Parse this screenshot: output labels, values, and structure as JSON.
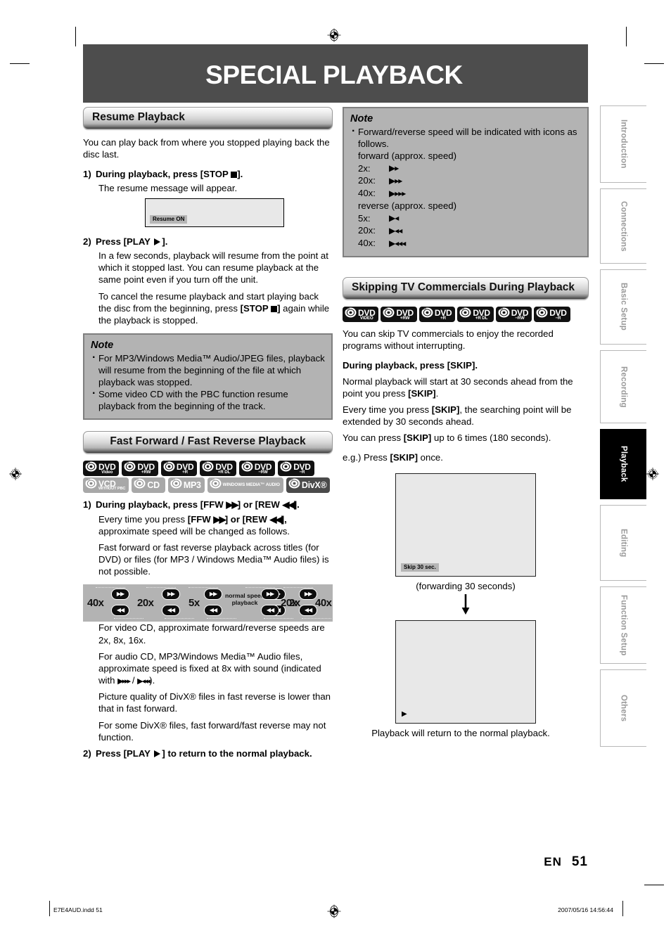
{
  "page": {
    "title": "SPECIAL PLAYBACK",
    "page_number": "51",
    "language_code": "EN",
    "footer_left": "E7E4AUD.indd   51",
    "footer_right": "2007/05/16   14:56:44"
  },
  "left_column": {
    "resume": {
      "heading": "Resume Playback",
      "intro": "You can play back from where you stopped playing back the disc last.",
      "step1": {
        "number": "1)",
        "title_a": "During playback, press ",
        "title_b": "[STOP ",
        "title_c": "].",
        "body": "The resume message will appear."
      },
      "screen": {
        "osd_label": "Resume ON"
      },
      "step2": {
        "number": "2)",
        "title_a": "Press ",
        "title_b": "[PLAY ",
        "title_c": "].",
        "body1": "In a few seconds, playback will resume from the point at which it stopped last. You can resume playback at the same point even if you turn off the unit.",
        "body2_a": "To cancel the resume playback and start playing back the disc from the beginning, press ",
        "body2_b": "[STOP ",
        "body2_c": "]",
        "body2_d": " again while the playback is stopped."
      },
      "note": {
        "title": "Note",
        "items": [
          "For MP3/Windows Media™ Audio/JPEG files, playback will resume from the beginning of the file at which playback was stopped.",
          "Some video CD with the PBC function resume playback from the beginning of the track."
        ]
      }
    },
    "ffw": {
      "heading": "Fast Forward / Fast Reverse Playback",
      "badges": [
        {
          "l1": "DVD",
          "l2": "Video",
          "style": "dark"
        },
        {
          "l1": "DVD",
          "l2": "+RW",
          "style": "dark"
        },
        {
          "l1": "DVD",
          "l2": "+R",
          "style": "dark"
        },
        {
          "l1": "DVD",
          "l2": "+R DL",
          "style": "dark"
        },
        {
          "l1": "DVD",
          "l2": "−RW",
          "style": "dark"
        },
        {
          "l1": "DVD",
          "l2": "−R",
          "style": "dark"
        },
        {
          "l1": "VCD",
          "l2": "WITHOUT PBC",
          "style": "grey"
        },
        {
          "l1": "CD",
          "l2": "",
          "style": "grey"
        },
        {
          "l1": "MP3",
          "l2": "",
          "style": "grey"
        },
        {
          "l1": "WINDOWS MEDIA™ AUDIO",
          "l2": "",
          "style": "grey"
        },
        {
          "l1": "DivX®",
          "l2": "",
          "style": "mid"
        }
      ],
      "step1": {
        "number": "1)",
        "title_a": "During playback, press ",
        "title_b": "[FFW ",
        "title_c": "] or ",
        "title_d": "[REW ",
        "title_e": "].",
        "body1_a": "Every time you press ",
        "body1_b": "[FFW ",
        "body1_c": "] or ",
        "body1_d": "[REW ",
        "body1_e": "],",
        "body1_f": " approximate speed will be changed as follows.",
        "body2": "Fast forward or fast reverse playback across titles (for DVD) or files (for MP3 / Windows Media™ Audio files) is not possible."
      },
      "diagram": {
        "reverse_speeds": [
          "40x",
          "20x",
          "5x"
        ],
        "center_label": "normal speed playback",
        "forward_speeds": [
          "2x",
          "20x",
          "40x"
        ]
      },
      "notes": [
        "For video CD, approximate forward/reverse speeds are 2x, 8x, 16x.",
        "For audio CD, MP3/Windows Media™ Audio files, approximate speed is fixed at 8x with sound (indicated with ▶▸▸▸ / ▶◂◂◂).",
        "Picture quality of DivX® files in fast reverse is lower than that in fast forward.",
        "For some DivX® files, fast forward/fast reverse may not function."
      ],
      "step2": {
        "number": "2)",
        "title_a": "Press ",
        "title_b": "[PLAY ",
        "title_c": "] to return to the normal playback."
      }
    }
  },
  "right_column": {
    "speed_note": {
      "title": "Note",
      "intro": "Forward/reverse speed will be indicated with icons as follows.",
      "forward_label": "forward (approx. speed)",
      "forward_rows": [
        {
          "speed": "2x:",
          "glyph": "▶▸"
        },
        {
          "speed": "20x:",
          "glyph": "▶▸▸"
        },
        {
          "speed": "40x:",
          "glyph": "▶▸▸▸"
        }
      ],
      "reverse_label": "reverse (approx. speed)",
      "reverse_rows": [
        {
          "speed": "5x:",
          "glyph": "▶◂"
        },
        {
          "speed": "20x:",
          "glyph": "▶◂◂"
        },
        {
          "speed": "40x:",
          "glyph": "▶◂◂◂"
        }
      ]
    },
    "skip": {
      "heading": "Skipping TV Commercials During Playback",
      "badges": [
        {
          "l1": "DVD",
          "l2": "VIDEO",
          "style": "dark"
        },
        {
          "l1": "DVD",
          "l2": "+RW",
          "style": "dark"
        },
        {
          "l1": "DVD",
          "l2": "+R",
          "style": "dark"
        },
        {
          "l1": "DVD",
          "l2": "+R DL",
          "style": "dark"
        },
        {
          "l1": "DVD",
          "l2": "−RW",
          "style": "dark"
        },
        {
          "l1": "DVD",
          "l2": "−R",
          "style": "dark"
        }
      ],
      "intro": "You can skip TV commercials to enjoy the recorded programs without interrupting.",
      "action_a": "During playback, press ",
      "action_b": "[SKIP].",
      "body1_a": "Normal playback will start at 30 seconds ahead from the point you press ",
      "body1_b": "[SKIP]",
      "body1_c": ".",
      "body2_a": "Every time you press ",
      "body2_b": "[SKIP]",
      "body2_c": ", the searching point will be extended by 30 seconds ahead.",
      "body3_a": "You can press ",
      "body3_b": "[SKIP]",
      "body3_c": " up to 6 times (180 seconds).",
      "example_a": "e.g.) Press ",
      "example_b": "[SKIP]",
      "example_c": " once.",
      "screen1_osd": "Skip 30 sec.",
      "screen1_caption": "(forwarding 30 seconds)",
      "arrow": "↓",
      "screen2_icon": "▶",
      "screen2_caption": "Playback will return to the normal playback."
    }
  },
  "tab_rail": {
    "tabs": [
      {
        "label": "Introduction",
        "active": false
      },
      {
        "label": "Connections",
        "active": false
      },
      {
        "label": "Basic Setup",
        "active": false
      },
      {
        "label": "Recording",
        "active": false
      },
      {
        "label": "Playback",
        "active": true
      },
      {
        "label": "Editing",
        "active": false
      },
      {
        "label": "Function Setup",
        "active": false
      },
      {
        "label": "Others",
        "active": false
      }
    ]
  }
}
